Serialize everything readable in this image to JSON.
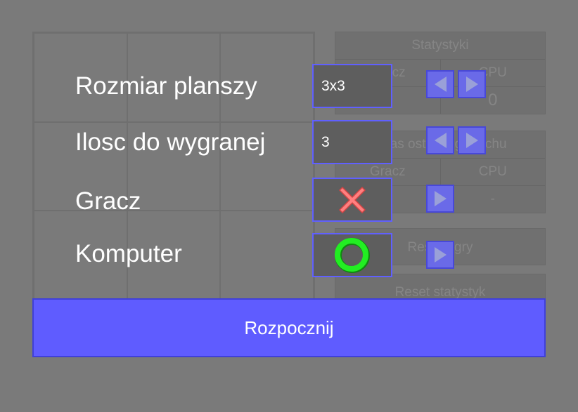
{
  "background": {
    "stats": {
      "title": "Statystyki",
      "player_col": "Gracz",
      "cpu_col": "CPU",
      "player_value": "0",
      "cpu_value": "0"
    },
    "last_move": {
      "title": "Czas ostatniego ruchu",
      "player_col": "Gracz",
      "cpu_col": "CPU",
      "player_value": "",
      "cpu_value": "-"
    },
    "restart_label": "Restart gry",
    "reset_stats_label": "Reset statystyk"
  },
  "settings": {
    "board_size": {
      "label": "Rozmiar planszy",
      "value": "3x3"
    },
    "win_count": {
      "label": "Ilosc do wygranej",
      "value": "3"
    },
    "player": {
      "label": "Gracz",
      "symbol_icon": "x-icon"
    },
    "computer": {
      "label": "Komputer",
      "symbol_icon": "o-icon"
    },
    "start_label": "Rozpocznij"
  },
  "colors": {
    "accent": "#5f5cff",
    "x_color": "#ff7a7a",
    "o_color": "#22ee22"
  }
}
